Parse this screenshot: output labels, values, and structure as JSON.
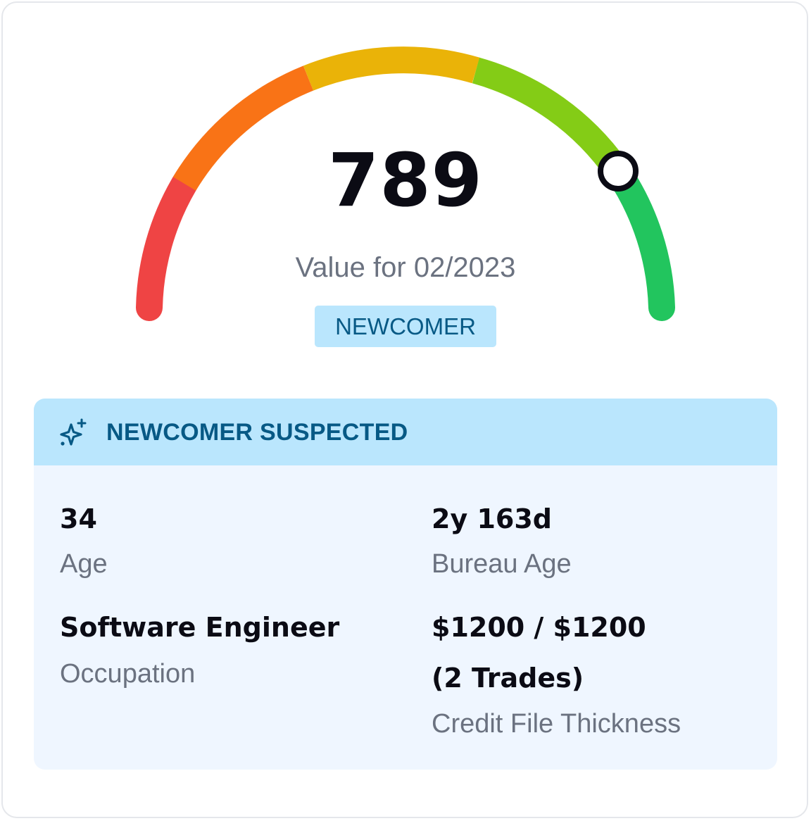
{
  "gauge": {
    "score": "789",
    "value_label": "Value for 02/2023",
    "badge": "NEWCOMER",
    "segment_colors": [
      "#ef4444",
      "#f97316",
      "#eab308",
      "#84cc16",
      "#22c55e"
    ],
    "marker_color": "#0b0b14"
  },
  "panel": {
    "title": "NEWCOMER SUSPECTED",
    "icon": "sparkle-icon",
    "header_color": "#bae6fd",
    "fields": {
      "age": {
        "value": "34",
        "label": "Age"
      },
      "bureau_age": {
        "value": "2y 163d",
        "label": "Bureau Age"
      },
      "occupation": {
        "value": "Software Engineer",
        "label": "Occupation"
      },
      "credit_file": {
        "value_line1": "$1200 / $1200",
        "value_line2": "(2 Trades)",
        "label": "Credit File Thickness"
      }
    }
  }
}
